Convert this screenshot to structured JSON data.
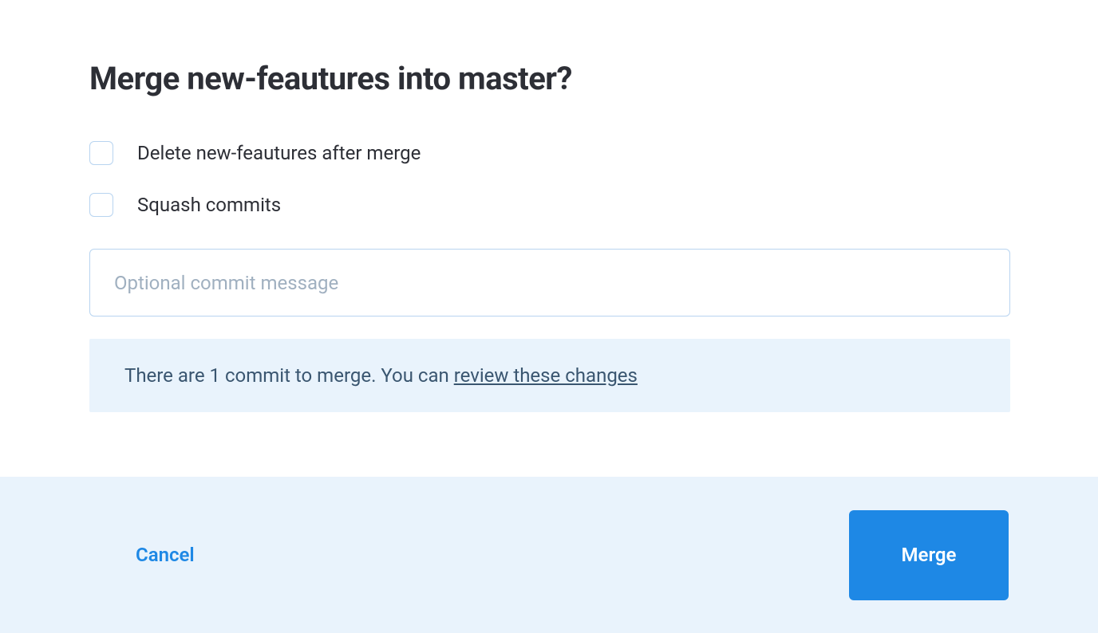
{
  "dialog": {
    "title": "Merge new-feautures into master?",
    "checkboxes": {
      "delete": {
        "label": "Delete new-feautures after merge",
        "checked": false
      },
      "squash": {
        "label": "Squash commits",
        "checked": false
      }
    },
    "commit_input": {
      "placeholder": "Optional commit message",
      "value": ""
    },
    "info": {
      "text_before": "There are 1 commit to merge. You can ",
      "link_text": "review these changes"
    },
    "footer": {
      "cancel_label": "Cancel",
      "merge_label": "Merge"
    }
  }
}
